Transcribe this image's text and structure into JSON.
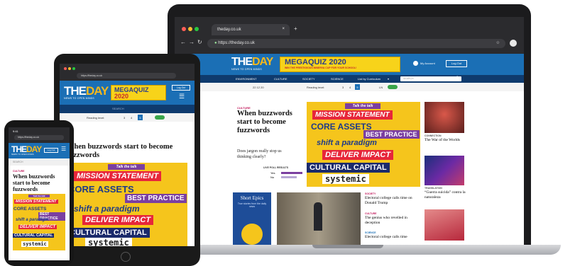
{
  "colors": {
    "brand_blue": "#1b6fb5",
    "brand_yellow": "#f5b81c",
    "poster_yellow": "#f5c51c",
    "red": "#e7263a",
    "purple": "#7b3fa0",
    "navy": "#0f3b6e"
  },
  "laptop": {
    "tab_title": "theday.co.uk",
    "tab_close": "×",
    "new_tab": "+",
    "url": "https://theday.co.uk",
    "logo_the": "THE",
    "logo_day": "DAY",
    "logo_sub": "NEWS TO OPEN MINDS",
    "megaquiz_title": "MEGAQUIZ 2020",
    "megaquiz_sub": "WIN THE PRESTIGIOUS MINERVA CUP FOR YOUR SCHOOL!",
    "my_account": "My Account",
    "logout": "Log Out",
    "nav": [
      "ENVIRONMENT",
      "CULTURE",
      "SOCIETY",
      "SCIENCE",
      "List by Curriculum"
    ],
    "search_placeholder": "SEARCH",
    "date": "22 12 20",
    "reading_level_label": "Reading level:",
    "levels": [
      "3",
      "4",
      "5"
    ],
    "language": "LN",
    "main_article": {
      "category": "CULTURE",
      "headline": "When buzzwords start to become fuzzwords",
      "question": "Does jargon really stop us thinking clearly?",
      "poll_title": "LIVE POLL RESULTS",
      "poll_yes": "Yes",
      "poll_no": "No"
    },
    "poster": {
      "talk": "Talk the talk",
      "line1": "MISSION STATEMENT",
      "line2": "CORE ASSETS",
      "line3": "BEST PRACTICE",
      "line4": "shift a paradigm",
      "line5": "DELIVER IMPACT",
      "line6": "CULTURAL CAPITAL",
      "line7": "systemic"
    },
    "short_epics": {
      "title": "Short Epics",
      "sub": "True stories from the daily news"
    },
    "side_list": [
      {
        "category": "SOCIETY",
        "title": "Electoral college calls time on Donald Trump"
      },
      {
        "category": "CULTURE",
        "title": "The genius who revelled in deception"
      },
      {
        "category": "SCIENCE",
        "title": "Electoral college calls time"
      }
    ],
    "right_col": [
      {
        "category": "CONNECTION",
        "title": "The War of the Worlds"
      },
      {
        "category": "TRANSLATION",
        "title": "“Guerra suicida” contra la naturaleza"
      }
    ]
  },
  "tablet": {
    "url": "https://theday.co.uk",
    "logo_the": "THE",
    "logo_day": "DAY",
    "logo_sub": "NEWS TO OPEN MINDS",
    "megaquiz_title": "MEGAQUIZ",
    "megaquiz_year": "2020",
    "login": "Log Out",
    "search_placeholder": "SEARCH",
    "reading_level_label": "Reading level:",
    "levels": [
      "3",
      "4",
      "5"
    ],
    "headline": "When buzzwords start to become fuzzwords",
    "poster": {
      "talk": "Talk the talk",
      "line1": "MISSION STATEMENT",
      "line2": "CORE ASSETS",
      "line3": "BEST PRACTICE",
      "line4": "shift a paradigm",
      "line5": "DELIVER IMPACT",
      "line6": "CULTURAL CAPITAL",
      "line7": "systemic"
    }
  },
  "phone": {
    "time": "9:41",
    "url": "https://theday.co.uk",
    "logo_the": "THE",
    "logo_day": "DAY",
    "logo_sub": "NEWS TO OPEN MINDS",
    "login": "Log Out",
    "search_placeholder": "SEARCH",
    "category": "CULTURE",
    "headline": "When buzzwords start to become fuzzwords",
    "poster": {
      "talk": "Talk the talk",
      "line1": "MISSION STATEMENT",
      "line2": "CORE ASSETS",
      "line3": "BEST PRACTICE",
      "line4": "shift a paradigm",
      "line5": "DELIVER IMPACT",
      "line6": "CULTURAL CAPITAL",
      "line7": "systemic"
    }
  }
}
